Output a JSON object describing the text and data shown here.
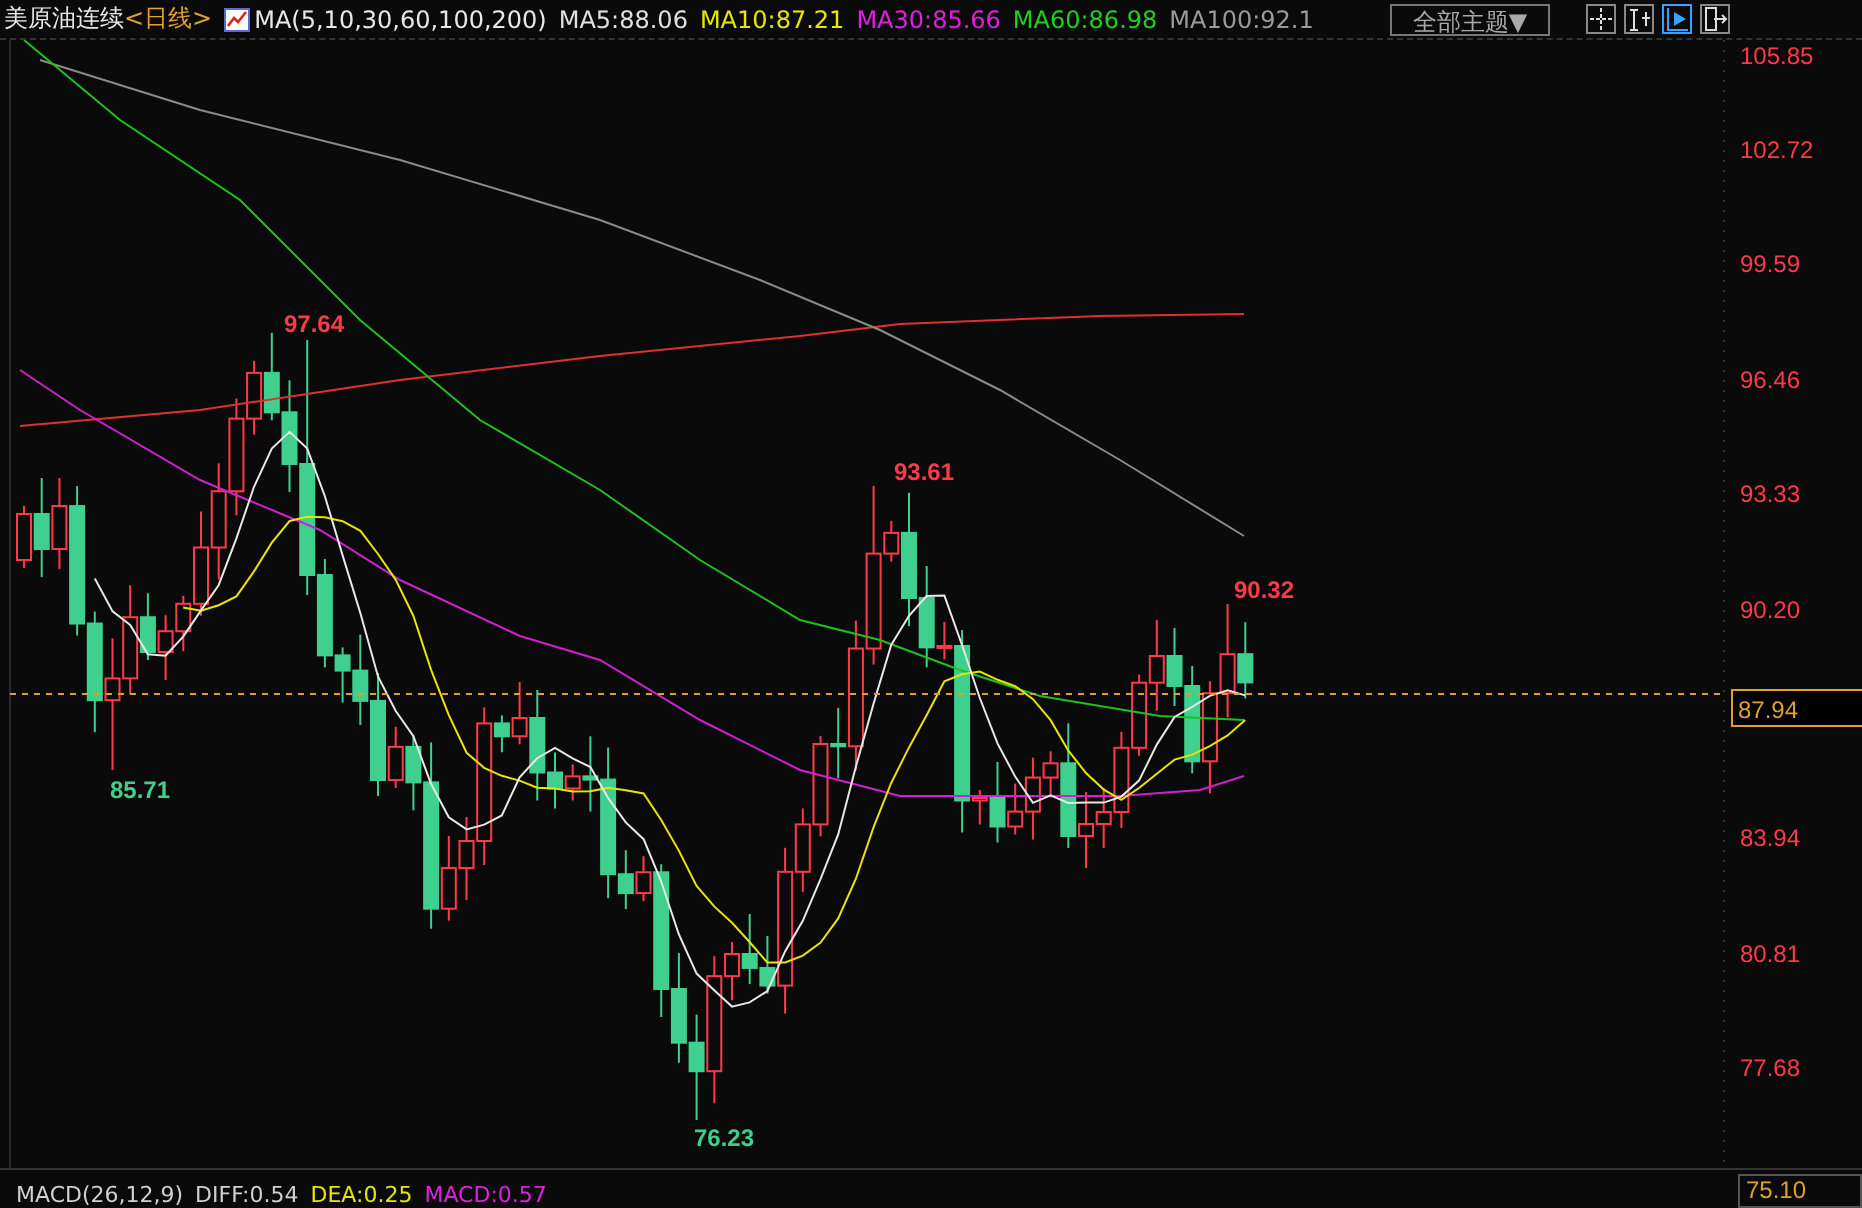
{
  "header": {
    "instrument": "美原油连续",
    "period": "<日线>",
    "indicator": "MA(5,10,30,60,100,200)",
    "ma_values": [
      {
        "label": "MA5:88.06",
        "color": "#e0e0e0"
      },
      {
        "label": "MA10:87.21",
        "color": "#e6e600"
      },
      {
        "label": "MA30:85.66",
        "color": "#e020e0"
      },
      {
        "label": "MA60:86.98",
        "color": "#20d020"
      },
      {
        "label": "MA100:92.1",
        "color": "#9a9a9a"
      }
    ]
  },
  "theme_dropdown": "全部主题▼",
  "toolbar_buttons": [
    {
      "kind": "grid",
      "selected": false
    },
    {
      "kind": "range",
      "selected": false
    },
    {
      "kind": "play",
      "selected": true
    },
    {
      "kind": "exit",
      "selected": false
    }
  ],
  "price_axis": {
    "ticks": [
      "105.85",
      "102.72",
      "99.59",
      "96.46",
      "93.33",
      "90.20",
      "83.94",
      "80.81",
      "77.68"
    ]
  },
  "price_annotations": [
    {
      "text": "97.64",
      "kind": "high"
    },
    {
      "text": "93.61",
      "kind": "high"
    },
    {
      "text": "90.32",
      "kind": "high"
    },
    {
      "text": "85.71",
      "kind": "low"
    },
    {
      "text": "76.23",
      "kind": "low"
    }
  ],
  "current_price": "87.94",
  "bottom_price": "75.10",
  "macd": [
    {
      "label": "MACD(26,12,9)",
      "color": "#d0d0d0"
    },
    {
      "label": "DIFF:0.54",
      "color": "#d0d0d0"
    },
    {
      "label": "DEA:0.25",
      "color": "#e6e600"
    },
    {
      "label": "MACD:0.57",
      "color": "#e020e0"
    }
  ]
}
